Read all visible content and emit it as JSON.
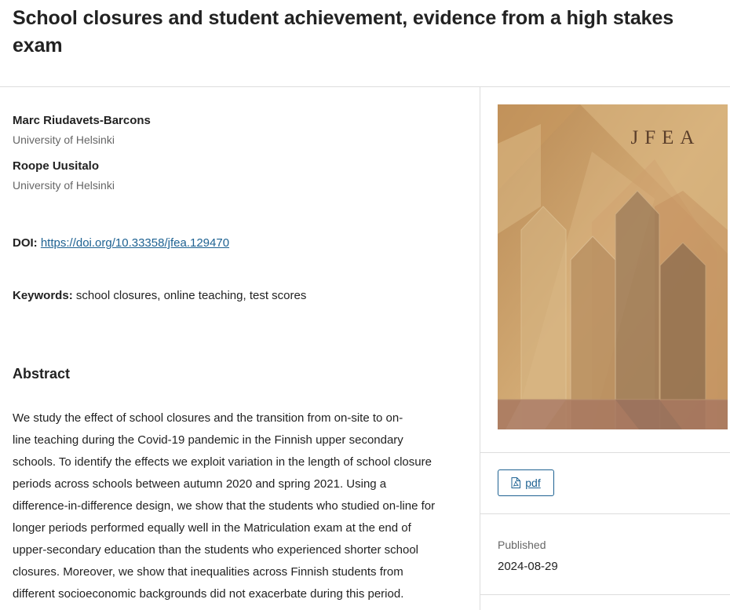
{
  "article": {
    "title": "School closures and student achievement, evidence from a high stakes exam"
  },
  "authors": [
    {
      "name": "Marc Riudavets-Barcons",
      "affiliation": "University of Helsinki"
    },
    {
      "name": "Roope Uusitalo",
      "affiliation": "University of Helsinki"
    }
  ],
  "doi": {
    "label": "DOI:",
    "url": "https://doi.org/10.33358/jfea.129470"
  },
  "keywords": {
    "label": "Keywords:",
    "value": "school closures, online teaching, test scores"
  },
  "abstract": {
    "heading": "Abstract",
    "lines": [
      "We study the effect of school closures and the transition from on-site to on-",
      "line teaching during the Covid-19 pandemic in the Finnish upper secondary",
      "schools. To identify the effects we exploit variation in the length of school closure",
      "periods across schools between autumn 2020 and spring 2021. Using a",
      "difference-in-difference design, we show that the students who studied on-line for",
      "longer periods performed equally well in the Matriculation exam at the end of",
      "upper-secondary education than the students who experienced shorter school",
      "closures. Moreover, we show that inequalities across Finnish students from",
      "different socioeconomic backgrounds did not exacerbate during this period."
    ]
  },
  "sidebar": {
    "cover_text": "JFEA",
    "pdf_label": "pdf",
    "pdf_icon": "pdf-file-icon",
    "published_label": "Published",
    "published_date": "2024-08-29"
  },
  "colors": {
    "link": "#1e6292",
    "cover_base": "#c9a06a"
  }
}
